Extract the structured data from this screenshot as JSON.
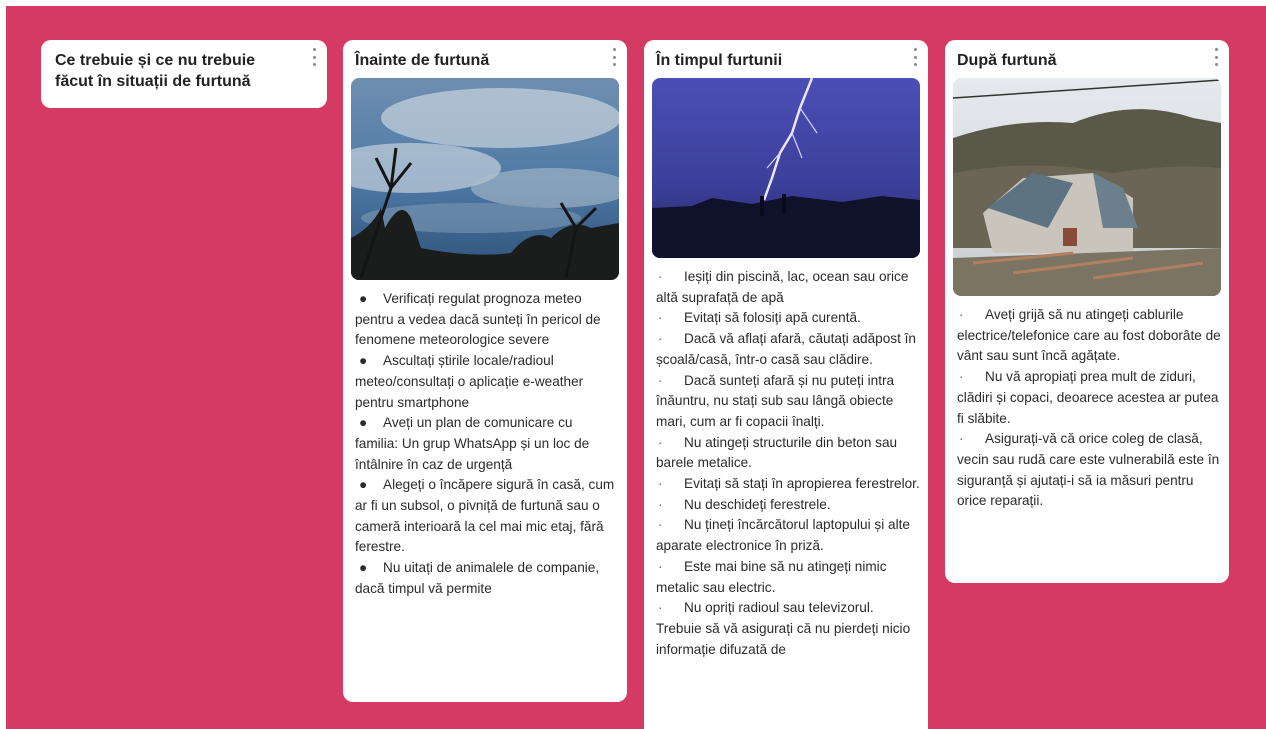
{
  "board": {
    "background": "#d43a63",
    "columns": [
      {
        "title": "Ce trebuie și ce nu trebuie făcut în situații de furtună"
      },
      {
        "title": "Înainte de furtună",
        "image_icon": "storm-clouds-sky-image",
        "bullet": "●",
        "items": [
          "Verificați regulat prognoza meteo pentru a vedea dacă sunteți în pericol de fenomene meteorologice severe",
          "Ascultați știrile locale/radioul meteo/consultați o aplicație e-weather pentru smartphone",
          "Aveți un plan de comunicare cu familia: Un grup WhatsApp și un loc de întâlnire în caz de urgență",
          "Alegeți o încăpere sigură în casă, cum ar fi un subsol, o pivniță de furtună sau o cameră interioară la cel mai mic etaj, fără ferestre.",
          "Nu uitați de animalele de companie, dacă timpul vă permite"
        ]
      },
      {
        "title": "În timpul furtunii",
        "image_icon": "lightning-strike-image",
        "bullet": "·",
        "items": [
          "Ieșiți din piscină, lac, ocean sau orice altă suprafață de apă",
          "Evitați să folosiți apă curentă.",
          "Dacă vă aflați afară, căutați adăpost în școală/casă, într-o casă sau clădire.",
          "Dacă sunteți afară și nu puteți intra înăuntru, nu stați sub sau lângă obiecte mari, cum ar fi copacii înalți.",
          "Nu atingeți structurile din beton sau barele metalice.",
          "Evitați să stați în apropierea ferestrelor.",
          "Nu deschideți ferestrele.",
          "Nu țineți încărcătorul laptopului și alte aparate electronice în priză.",
          "Este mai bine să nu atingeți nimic metalic sau electric.",
          "Nu opriți radioul sau televizorul. Trebuie să vă asigurați că nu pierdeți nicio informație difuzată de"
        ]
      },
      {
        "title": "După furtună",
        "image_icon": "storm-damaged-house-image",
        "bullet": "·",
        "items": [
          "Aveți grijă să nu atingeți cablurile electrice/telefonice care au fost doborâte de vânt sau sunt încă agățate.",
          "Nu vă apropiați prea mult de ziduri, clădiri și copaci, deoarece acestea ar putea fi slăbite.",
          "Asigurați-vă că orice coleg de clasă, vecin sau rudă care este vulnerabilă este în siguranță și ajutați-i să ia măsuri pentru orice reparații."
        ]
      }
    ]
  }
}
